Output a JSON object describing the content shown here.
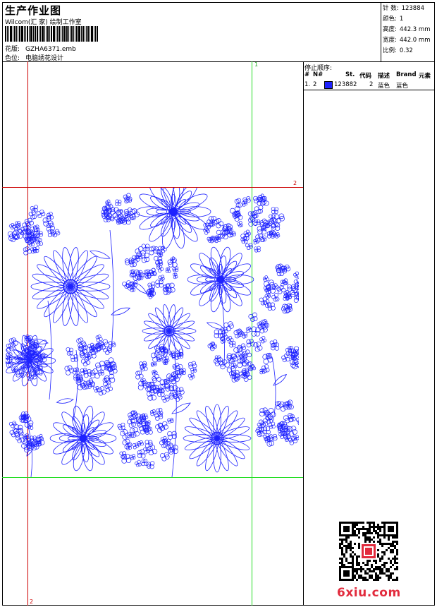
{
  "header": {
    "title": "生产作业图",
    "company": "Wilcom(汇 家) 绘制工作室",
    "pattern_label": "花版:",
    "pattern_value": "GZHA6371.emb",
    "color_label": "色位:",
    "color_value": "电脑绣花设计"
  },
  "info": {
    "stitches_label": "针 数:",
    "stitches_value": "123884",
    "colors_label": "颜色:",
    "colors_value": "1",
    "height_label": "高度:",
    "height_value": "442.3 mm",
    "width_label": "宽度:",
    "width_value": "442.0 mm",
    "scale_label": "比例:",
    "scale_value": "0.32"
  },
  "stop_sequence": {
    "title": "停止顺序:",
    "columns": [
      "#",
      "N#",
      "St.",
      "代码",
      "描述",
      "Brand",
      "元素"
    ],
    "rows": [
      {
        "num": "1.",
        "n": "2",
        "stitches": "123882",
        "code": "2",
        "desc": "蓝色",
        "brand": "蓝色",
        "swatch_color": "#1e22ff"
      }
    ]
  },
  "guides": {
    "top_label": "1",
    "right_label": "2",
    "bottom_label": "2",
    "guide_colors": {
      "vertical_green": "#22dd22",
      "red": "#cc0000"
    }
  },
  "design": {
    "stroke_color": "#1e22ff",
    "motifs": [
      "flower-cluster",
      "daisy",
      "dahlia",
      "leaf"
    ]
  },
  "footer": {
    "brand_text": "6xiu.com",
    "qr_icon": "qr-code-icon"
  }
}
